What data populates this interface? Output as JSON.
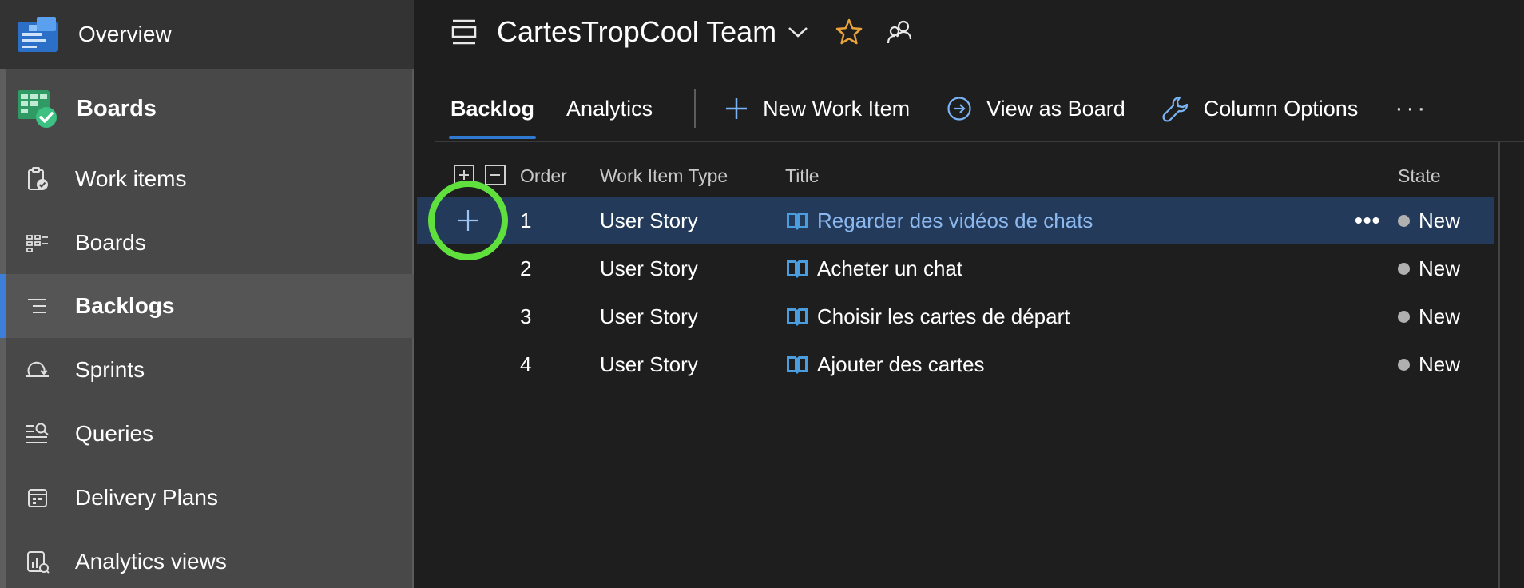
{
  "sidebar": {
    "overview_label": "Overview",
    "hub_label": "Boards",
    "items": [
      {
        "label": "Work items",
        "icon": "work-items-icon"
      },
      {
        "label": "Boards",
        "icon": "boards-icon"
      },
      {
        "label": "Backlogs",
        "icon": "backlogs-icon",
        "selected": true
      },
      {
        "label": "Sprints",
        "icon": "sprints-icon"
      },
      {
        "label": "Queries",
        "icon": "queries-icon"
      },
      {
        "label": "Delivery Plans",
        "icon": "delivery-plans-icon"
      },
      {
        "label": "Analytics views",
        "icon": "analytics-views-icon"
      }
    ]
  },
  "header": {
    "team_name": "CartesTropCool Team"
  },
  "pivots": {
    "backlog": "Backlog",
    "analytics": "Analytics"
  },
  "commands": {
    "new_work_item": "New Work Item",
    "view_as_board": "View as Board",
    "column_options": "Column Options",
    "more": "···"
  },
  "grid": {
    "columns": {
      "order": "Order",
      "type": "Work Item Type",
      "title": "Title",
      "state": "State"
    },
    "rows": [
      {
        "order": "1",
        "type": "User Story",
        "title": "Regarder des vidéos de chats",
        "state": "New",
        "selected": true
      },
      {
        "order": "2",
        "type": "User Story",
        "title": "Acheter un chat",
        "state": "New"
      },
      {
        "order": "3",
        "type": "User Story",
        "title": "Choisir les cartes de départ",
        "state": "New"
      },
      {
        "order": "4",
        "type": "User Story",
        "title": "Ajouter des cartes",
        "state": "New"
      }
    ],
    "row_more": "•••"
  },
  "colors": {
    "accent": "#2f7ad0",
    "selected_row": "#233a5a",
    "highlight_ring": "#5fe03c",
    "star": "#e8a33a",
    "story_icon": "#4a9ee0"
  }
}
